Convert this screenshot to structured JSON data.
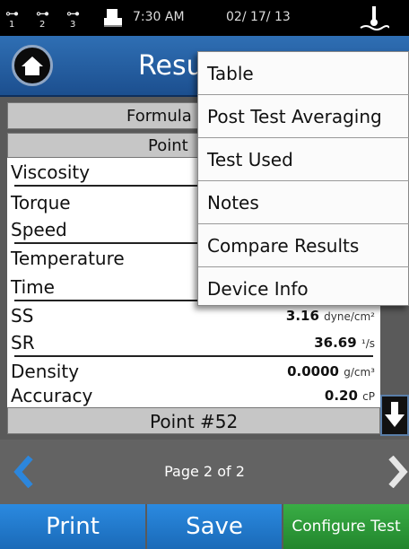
{
  "status_bar": {
    "usb_ports": [
      "1",
      "2",
      "3"
    ],
    "time": "7:30 AM",
    "date": "02/ 17/ 13",
    "icons": [
      "usb-icon",
      "printer-icon",
      "temperature-probe-icon"
    ]
  },
  "header": {
    "title": "Resu",
    "home_icon": "home-icon"
  },
  "table": {
    "formula_row": "Formula",
    "point_header": "Point",
    "rows": [
      {
        "label": "Viscosity"
      },
      {
        "label": "Torque"
      },
      {
        "label": "Speed"
      },
      {
        "label": "Temperature"
      },
      {
        "label": "Time"
      },
      {
        "label": "SS",
        "value": "3.16",
        "unit": "dyne/cm²"
      },
      {
        "label": "SR",
        "value": "36.69",
        "unit": "¹/s"
      },
      {
        "label": "Density",
        "value": "0.0000",
        "unit": "g/cm³"
      },
      {
        "label": "Accuracy",
        "value": "0.20",
        "unit": "cP"
      }
    ],
    "footer_point": "Point #52"
  },
  "menu": {
    "items": [
      "Table",
      "Post Test Averaging",
      "Test Used",
      "Notes",
      "Compare Results",
      "Device Info"
    ]
  },
  "pager": {
    "text": "Page 2 of 2"
  },
  "buttons": {
    "print": "Print",
    "save": "Save",
    "configure": "Configure Test"
  },
  "colors": {
    "header_blue": "#2a64a8",
    "button_blue": "#1d7dd0",
    "button_green": "#2f9a3a",
    "arrow_blue": "#2c86dc"
  }
}
